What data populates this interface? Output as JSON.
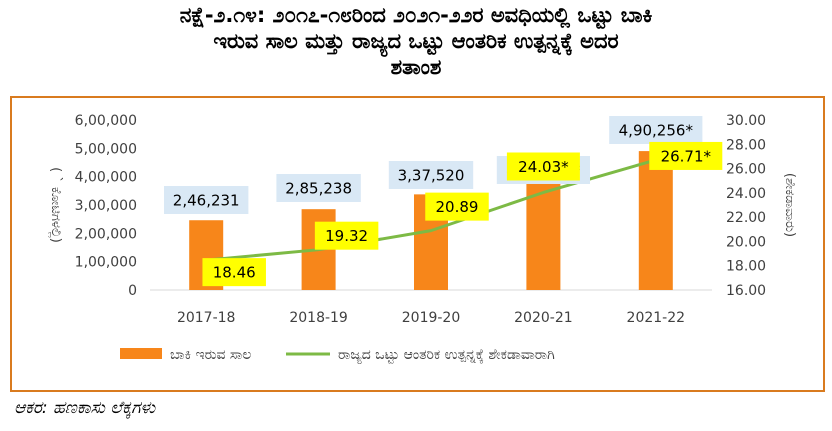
{
  "title_lines": [
    "ನಕ್ಷೆ-೨.೧೪: ೨೦೧೭-೧೮ರಿಂದ ೨೦೨೧-೨೨ರ ಅವಧಿಯಲ್ಲಿ ಒಟ್ಟು ಬಾಕಿ",
    "ಇರುವ ಸಾಲ ಮತ್ತು ರಾಜ್ಯದ ಒಟ್ಟು ಆಂತರಿಕ ಉತ್ಪನ್ನಕ್ಕೆ ಅದರ",
    "ಶತಾಂಶ"
  ],
  "source": "ಆಕರ: ಹಣಕಾಸು ಲೆಕ್ಕಗಳು",
  "colors": {
    "bar": "#f7861a",
    "line": "#7dba45",
    "label_bg_bar": "#d9e8f5",
    "label_bg_line": "#ffff00",
    "frame": "#d97b1f"
  },
  "chart_data": {
    "type": "bar",
    "categories": [
      "2017-18",
      "2018-19",
      "2019-20",
      "2020-21",
      "2021-22"
    ],
    "series": [
      {
        "name": "ಬಾಕಿ ಇರುವ ಸಾಲ",
        "type": "bar",
        "axis": "left",
        "values": [
          246231,
          285238,
          337520,
          415926,
          490256
        ],
        "labels": [
          "2,46,231",
          "2,85,238",
          "3,37,520",
          "4,15,926*",
          "4,90,256*"
        ]
      },
      {
        "name": "ರಾಜ್ಯದ ಒಟ್ಟು ಆಂತರಿಕ ಉತ್ಪನ್ನಕ್ಕೆ ಶೇಕಡಾವಾರಾಗಿ",
        "type": "line",
        "axis": "right",
        "values": [
          18.46,
          19.32,
          20.89,
          24.03,
          26.71
        ],
        "labels": [
          "18.46",
          "19.32",
          "20.89",
          "24.03*",
          "26.71*"
        ]
      }
    ],
    "ylabel": "( ` ಕೋಟಿಗಳಲ್ಲಿ)",
    "y2label": "(ಶೇಕಡಾವಾರು)",
    "ylim": [
      0,
      600000
    ],
    "y2lim": [
      16,
      30
    ],
    "yticks": [
      "0",
      "1,00,000",
      "2,00,000",
      "3,00,000",
      "4,00,000",
      "5,00,000",
      "6,00,000"
    ],
    "y2ticks": [
      "16.00",
      "18.00",
      "20.00",
      "22.00",
      "24.00",
      "26.00",
      "28.00",
      "30.00"
    ],
    "legend": "bottom",
    "grid": false
  }
}
